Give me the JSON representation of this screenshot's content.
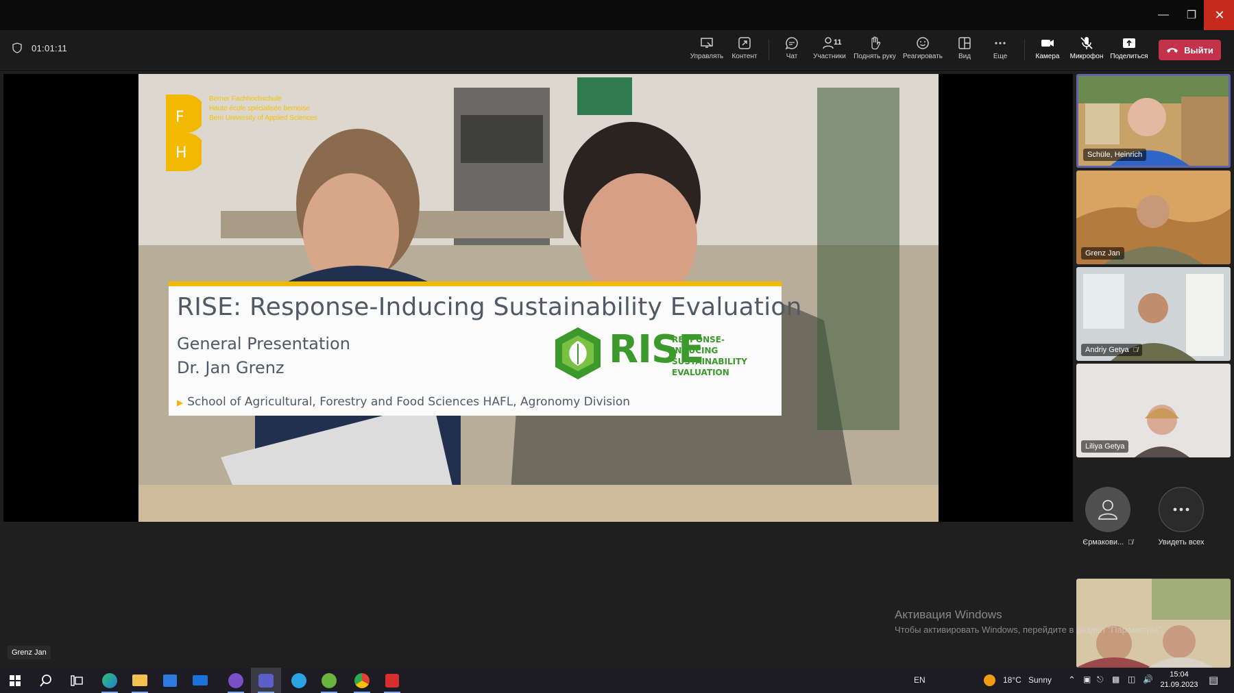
{
  "meeting": {
    "elapsed": "01:01:11"
  },
  "toolbar": {
    "manage": "Управлять",
    "content": "Контент",
    "chat": "Чат",
    "participants": "Участники",
    "participants_count": "11",
    "raise_hand": "Поднять руку",
    "react": "Реагировать",
    "view": "Вид",
    "more": "Еще",
    "camera": "Камера",
    "mic": "Микрофон",
    "share": "Поделиться",
    "leave": "Выйти"
  },
  "slide": {
    "org_line1": "Berner Fachhochschule",
    "org_line2": "Haute école spécialisée bernoise",
    "org_line3": "Bern University of Applied Sciences",
    "logo_letters": [
      "F",
      "H"
    ],
    "title": "RISE: Response-Inducing Sustainability Evaluation",
    "subtitle": "General Presentation",
    "presenter": "Dr. Jan Grenz",
    "school": "School of Agricultural, Forestry and Food Sciences HAFL, Agronomy Division",
    "rise_word": "RISE",
    "rise_tag_1": "RESPONSE-INDUCING",
    "rise_tag_2": "SUSTAINABILITY",
    "rise_tag_3": "EVALUATION"
  },
  "participants": [
    {
      "name": "Schüle, Heinrich",
      "muted": false,
      "active": true
    },
    {
      "name": "Grenz Jan",
      "muted": false,
      "active": false
    },
    {
      "name": "Andriy Getya",
      "muted": true,
      "active": false
    },
    {
      "name": "Liliya Getya",
      "muted": false,
      "active": false
    }
  ],
  "extra": {
    "avatar_name": "Єрмакови...",
    "see_all": "Увидеть всех"
  },
  "speaker_label": "Grenz Jan",
  "watermark": {
    "title": "Активация Windows",
    "subtitle": "Чтобы активировать Windows, перейдите в раздел \"Параметры\"."
  },
  "taskbar": {
    "lang": "EN",
    "temperature": "18°C",
    "weather": "Sunny",
    "time": "15:04",
    "date": "21.09.2023"
  },
  "colors": {
    "leave": "#c4314b",
    "accent": "#6264a7",
    "brand_yellow": "#f3b800",
    "rise_green": "#3c9a2d"
  }
}
